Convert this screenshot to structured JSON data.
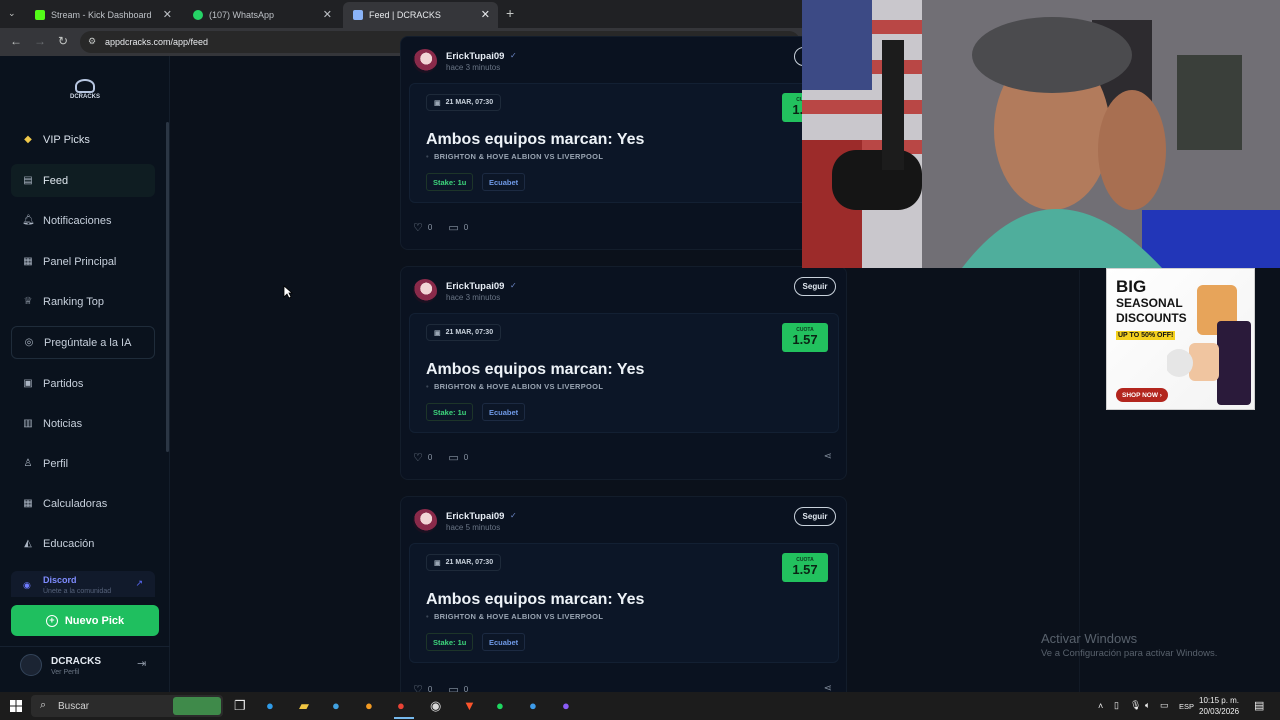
{
  "browser": {
    "tabs": [
      {
        "title": "Stream - Kick Dashboard",
        "active": false,
        "fav_color": "#53fc18"
      },
      {
        "title": "(107) WhatsApp",
        "active": false,
        "fav_color": "#25d366"
      },
      {
        "title": "Feed | DCRACKS",
        "active": true,
        "fav_color": "#8ab4f8"
      }
    ],
    "url": "appdcracks.com/app/feed"
  },
  "sidebar": {
    "logo_text": "DCRACKS",
    "items": [
      {
        "label": "VIP Picks",
        "icon": "diamond-icon",
        "glyph": "◆"
      },
      {
        "label": "Feed",
        "icon": "feed-icon",
        "glyph": "▤"
      },
      {
        "label": "Notificaciones",
        "icon": "bell-icon",
        "glyph": "🔔︎"
      },
      {
        "label": "Panel Principal",
        "icon": "grid-icon",
        "glyph": "▦"
      },
      {
        "label": "Ranking Top",
        "icon": "trophy-icon",
        "glyph": "♕"
      },
      {
        "label": "Pregúntale a la IA",
        "icon": "ai-icon",
        "glyph": "◎"
      },
      {
        "label": "Partidos",
        "icon": "calendar-icon",
        "glyph": "▣"
      },
      {
        "label": "Noticias",
        "icon": "news-icon",
        "glyph": "▥"
      },
      {
        "label": "Perfil",
        "icon": "user-icon",
        "glyph": "♙"
      },
      {
        "label": "Calculadoras",
        "icon": "calculator-icon",
        "glyph": "▦"
      },
      {
        "label": "Educación",
        "icon": "education-icon",
        "glyph": "◭"
      }
    ],
    "discord": {
      "title": "Discord",
      "subtitle": "Únete a la comunidad"
    },
    "new_pick_label": "Nuevo Pick",
    "user": {
      "name": "DCRACKS",
      "subtitle": "Ver Perfil"
    }
  },
  "feed": {
    "posts": [
      {
        "author": "ErickTupai09",
        "time": "hace 3 minutos",
        "follow_label": "Seguir",
        "date": "21 MAR, 07:30",
        "odds_label": "CUOTA",
        "odds": "1.57",
        "market": "Ambos equipos marcan: Yes",
        "match": "BRIGHTON & HOVE ALBION VS LIVERPOOL",
        "stake": "Stake: 1u",
        "bookmaker": "Ecuabet",
        "likes": "0",
        "comments": "0"
      },
      {
        "author": "ErickTupai09",
        "time": "hace 3 minutos",
        "follow_label": "Seguir",
        "date": "21 MAR, 07:30",
        "odds_label": "CUOTA",
        "odds": "1.57",
        "market": "Ambos equipos marcan: Yes",
        "match": "BRIGHTON & HOVE ALBION VS LIVERPOOL",
        "stake": "Stake: 1u",
        "bookmaker": "Ecuabet",
        "likes": "0",
        "comments": "0"
      },
      {
        "author": "ErickTupai09",
        "time": "hace 5 minutos",
        "follow_label": "Seguir",
        "date": "21 MAR, 07:30",
        "odds_label": "CUOTA",
        "odds": "1.57",
        "market": "Ambos equipos marcan: Yes",
        "match": "BRIGHTON & HOVE ALBION VS LIVERPOOL",
        "stake": "Stake: 1u",
        "bookmaker": "Ecuabet",
        "likes": "0",
        "comments": "0"
      }
    ]
  },
  "ad": {
    "line1": "BIG",
    "line2": "SEASONAL",
    "line3": "DISCOUNTS",
    "line4": "UP TO 50% OFF!",
    "cta": "SHOP NOW"
  },
  "watermark": {
    "title": "Activar Windows",
    "subtitle": "Ve a Configuración para activar Windows."
  },
  "taskbar": {
    "search_placeholder": "Buscar",
    "lang": "ESP",
    "time": "10:15 p. m.",
    "date": "20/03/2026"
  }
}
